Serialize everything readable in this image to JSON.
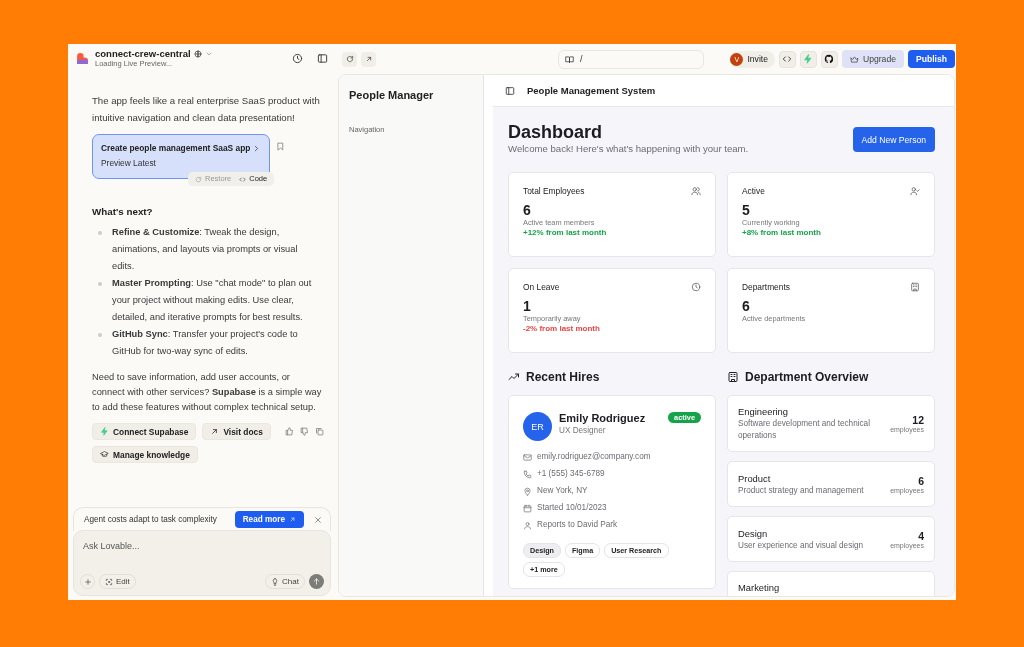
{
  "chat": {
    "project": {
      "name": "connect-crew-central",
      "status": "Loading Live Preview..."
    },
    "intro": "The app feels like a real enterprise SaaS product with intuitive navigation and clean data presentation!",
    "version_card": {
      "title": "Create people management SaaS app",
      "subtitle": "Preview Latest",
      "actions": [
        {
          "kind": "restore",
          "label": "Restore",
          "disabled": true
        },
        {
          "kind": "code",
          "label": "Code",
          "disabled": false
        }
      ]
    },
    "heading": "What's next?",
    "bullets": [
      "**Refine & Customize**: Tweak the design, animations, and layouts via prompts or visual edits.",
      "**Master Prompting**: Use \"chat mode\" to plan out your project without making edits. Use clear, detailed, and iterative prompts for best results.",
      "**GitHub Sync**: Transfer your project's code to GitHub for two-way sync of edits."
    ],
    "closing": "Need to save information, add user accounts, or connect with other services? **Supabase** is a simple way to add these features without complex technical setup.",
    "actions": [
      {
        "kind": "supabase",
        "label": "Connect Supabase"
      },
      {
        "kind": "link",
        "label": "Visit docs"
      },
      {
        "kind": "knowledge",
        "label": "Manage knowledge"
      }
    ],
    "notice": {
      "text": "Agent costs adapt to task complexity",
      "button": "Read more"
    },
    "input": {
      "placeholder": "Ask Lovable...",
      "edit": "Edit",
      "chat": "Chat"
    }
  },
  "toolbar": {
    "path": "/",
    "avatar": "V",
    "invite": "Invite",
    "upgrade": "Upgrade",
    "publish": "Publish"
  },
  "app": {
    "brand": "People Manager",
    "nav_heading": "Navigation",
    "header_title": "People Management System",
    "title": "Dashboard",
    "subtitle": "Welcome back! Here's what's happening with your team.",
    "add_button": "Add New Person",
    "stats": [
      {
        "title": "Total Employees",
        "value": "6",
        "note": "Active team members",
        "change": "+12% from last month",
        "color": "#16a34a"
      },
      {
        "title": "Active",
        "value": "5",
        "note": "Currently working",
        "change": "+8% from last month",
        "color": "#16a34a"
      },
      {
        "title": "On Leave",
        "value": "1",
        "note": "Temporarily away",
        "change": "-2% from last month",
        "color": "#ef4444"
      },
      {
        "title": "Departments",
        "value": "6",
        "note": "Active departments"
      }
    ],
    "recent_hires": {
      "title": "Recent Hires",
      "people": [
        {
          "initials": "ER",
          "name": "Emily Rodriguez",
          "role": "UX Designer",
          "status": "active",
          "details": [
            {
              "kind": "email",
              "text": "emily.rodriguez@company.com"
            },
            {
              "kind": "phone",
              "text": "+1 (555) 345-6789"
            },
            {
              "kind": "location",
              "text": "New York, NY"
            },
            {
              "kind": "calendar",
              "text": "Started 10/01/2023"
            },
            {
              "kind": "person",
              "text": "Reports to David Park"
            }
          ],
          "tags": [
            {
              "label": "Design",
              "highlighted": true
            },
            {
              "label": "Figma",
              "highlighted": false
            },
            {
              "label": "User Research",
              "highlighted": false
            },
            {
              "label": "+1 more",
              "highlighted": false
            }
          ]
        }
      ]
    },
    "departments": {
      "title": "Department Overview",
      "items": [
        {
          "name": "Engineering",
          "description": "Software development and technical operations",
          "count": "12",
          "unit": "employees"
        },
        {
          "name": "Product",
          "description": "Product strategy and management",
          "count": "6",
          "unit": "employees"
        },
        {
          "name": "Design",
          "description": "User experience and visual design",
          "count": "4",
          "unit": "employees"
        },
        {
          "name": "Marketing"
        }
      ]
    }
  }
}
